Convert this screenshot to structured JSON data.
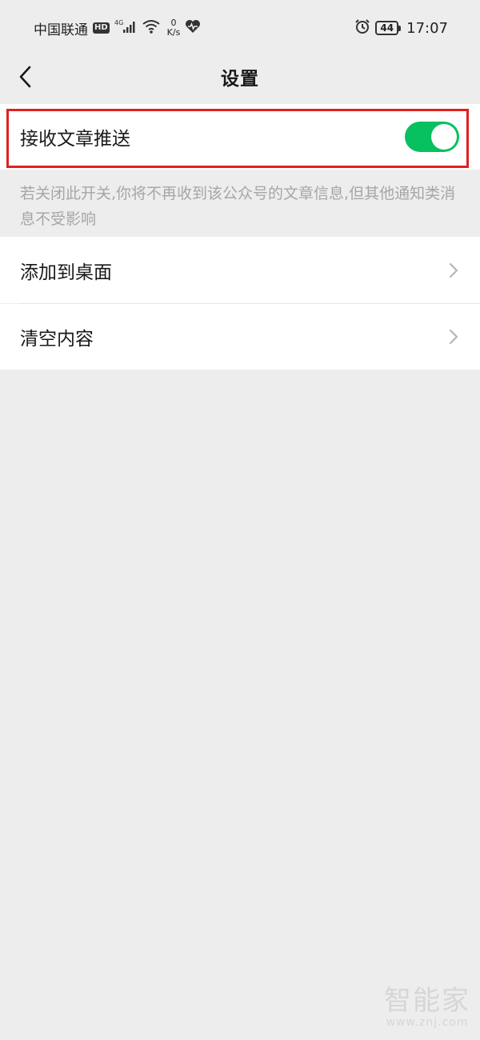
{
  "status_bar": {
    "carrier": "中国联通",
    "hd": "HD",
    "network": "4G",
    "net_speed_value": "0",
    "net_speed_unit": "K/s",
    "battery": "44",
    "time": "17:07"
  },
  "nav": {
    "title": "设置"
  },
  "settings": {
    "receive_push": {
      "label": "接收文章推送",
      "enabled": true
    },
    "hint": "若关闭此开关,你将不再收到该公众号的文章信息,但其他通知类消息不受影响",
    "add_to_desktop": {
      "label": "添加到桌面"
    },
    "clear_content": {
      "label": "清空内容"
    }
  },
  "watermark": {
    "text": "智能家",
    "url": "www.znj.com"
  },
  "colors": {
    "toggle_on": "#07c160",
    "highlight": "#e02020",
    "background": "#ededed"
  },
  "icons": [
    "back-arrow-icon",
    "chevron-right-icon",
    "signal-icon",
    "wifi-icon",
    "heart-icon",
    "alarm-icon",
    "battery-icon"
  ]
}
